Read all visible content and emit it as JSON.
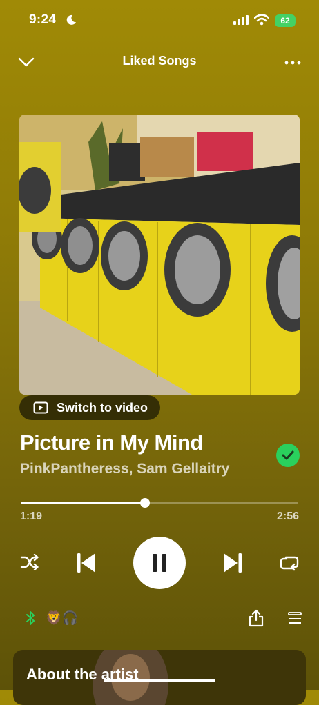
{
  "status_bar": {
    "time": "9:24",
    "battery": "62"
  },
  "header": {
    "title": "Liked Songs"
  },
  "video_toggle": {
    "label": "Switch to video"
  },
  "track": {
    "title": "Picture in My Mind",
    "artists": "PinkPantheress, Sam Gellaitry"
  },
  "progress": {
    "elapsed": "1:19",
    "total": "2:56",
    "fraction": 0.4489
  },
  "device_row": {
    "emoji": "🦁🎧"
  },
  "about": {
    "label": "About the artist"
  },
  "colors": {
    "accent_green": "#2ad05d",
    "background": "#8f7b07"
  }
}
